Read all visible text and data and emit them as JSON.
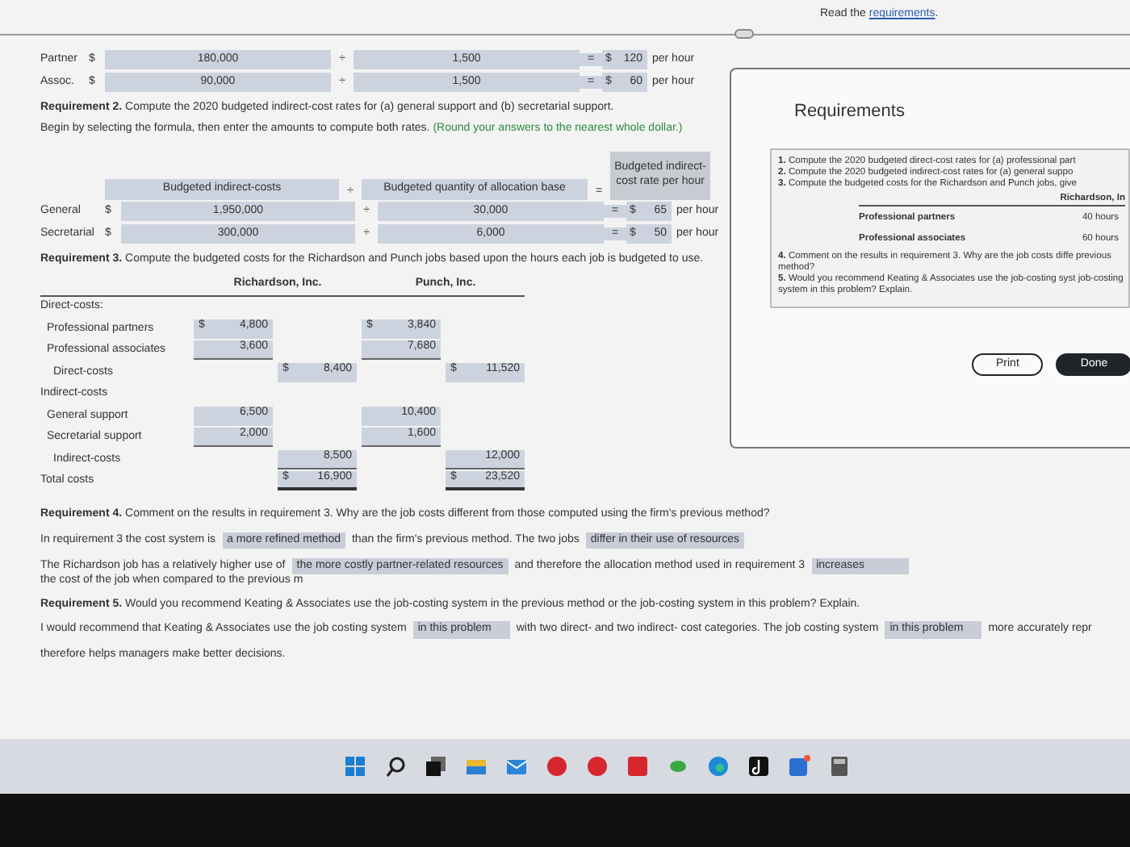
{
  "header": {
    "prefix": "Read the ",
    "link": "requirements",
    "suffix": "."
  },
  "direct_rates": {
    "rows": [
      {
        "label": "Partner",
        "currency": "$",
        "cost": "180,000",
        "divide": "÷",
        "quantity": "1,500",
        "equals": "=",
        "rate_currency": "$",
        "rate": "120",
        "unit": "per hour"
      },
      {
        "label": "Assoc.",
        "currency": "$",
        "cost": "90,000",
        "divide": "÷",
        "quantity": "1,500",
        "equals": "=",
        "rate_currency": "$",
        "rate": "60",
        "unit": "per hour"
      }
    ]
  },
  "requirement_2": {
    "title": "**Requirement 2.** Compute the 2020 budgeted indirect-cost rates for (a) general support and (b) secretarial support.",
    "instruction": "Begin by selecting the formula, then enter the amounts to compute both rates.",
    "hint": "(Round your answers to the nearest whole dollar.)",
    "formula": {
      "numerator": "Budgeted indirect-costs",
      "divide": "÷",
      "denominator": "Budgeted quantity of allocation base",
      "equals": "=",
      "result": "Budgeted indirect-cost rate per hour"
    },
    "rows": [
      {
        "label": "General",
        "currency": "$",
        "cost": "1,950,000",
        "divide": "÷",
        "quantity": "30,000",
        "equals": "=",
        "rate_currency": "$",
        "rate": "65",
        "unit": "per hour"
      },
      {
        "label": "Secretarial",
        "currency": "$",
        "cost": "300,000",
        "divide": "÷",
        "quantity": "6,000",
        "equals": "=",
        "rate_currency": "$",
        "rate": "50",
        "unit": "per hour"
      }
    ]
  },
  "requirement_3": {
    "title": "**Requirement 3.** Compute the budgeted costs for the Richardson and Punch jobs based upon the hours each job is budgeted to use.",
    "columns": [
      "Richardson, Inc.",
      "Punch, Inc."
    ],
    "rows": [
      {
        "kind": "heading",
        "label": "Direct-costs:"
      },
      {
        "kind": "item",
        "label": "Professional partners",
        "values": [
          {
            "currency": "$",
            "amount": "4,800"
          },
          {
            "currency": "$",
            "amount": "3,840"
          }
        ]
      },
      {
        "kind": "item",
        "label": "Professional associates",
        "values": [
          {
            "amount": "3,600"
          },
          {
            "amount": "7,680"
          }
        ]
      },
      {
        "kind": "subtotal",
        "label": "Direct-costs",
        "values": [
          {
            "currency": "$",
            "amount": "8,400"
          },
          {
            "currency": "$",
            "amount": "11,520"
          }
        ]
      },
      {
        "kind": "heading",
        "label": "Indirect-costs"
      },
      {
        "kind": "item",
        "label": "General support",
        "values": [
          {
            "amount": "6,500"
          },
          {
            "amount": "10,400"
          }
        ]
      },
      {
        "kind": "item",
        "label": "Secretarial support",
        "values": [
          {
            "amount": "2,000"
          },
          {
            "amount": "1,600"
          }
        ]
      },
      {
        "kind": "subtotal",
        "label": "Indirect-costs",
        "values": [
          {
            "amount": "8,500"
          },
          {
            "amount": "12,000"
          }
        ]
      },
      {
        "kind": "total",
        "label": "Total costs",
        "values": [
          {
            "currency": "$",
            "amount": "16,900"
          },
          {
            "currency": "$",
            "amount": "23,520"
          }
        ]
      }
    ]
  },
  "requirement_4": {
    "title": "**Requirement 4.** Comment on the results in requirement 3. Why are the job costs different from those computed using the firm's previous method?",
    "sentences": [
      [
        {
          "kind": "text",
          "text": "In requirement 3 the cost system is"
        },
        {
          "kind": "answer",
          "text": "a more refined method"
        },
        {
          "kind": "text",
          "text": "than the firm's previous method. The two jobs"
        },
        {
          "kind": "answer",
          "text": "differ in their use of resources"
        }
      ],
      [
        {
          "kind": "text",
          "text": "The Richardson job has a relatively higher use of"
        },
        {
          "kind": "answer",
          "text": "the more costly partner-related resources"
        },
        {
          "kind": "text",
          "text": "and therefore the allocation method used in requirement 3"
        },
        {
          "kind": "answer",
          "text": "increases"
        },
        {
          "kind": "text",
          "text": "the cost of the job when compared to the previous m"
        }
      ]
    ]
  },
  "requirement_5": {
    "title": "**Requirement 5.** Would you recommend Keating & Associates use the job-costing system in the previous method or the job-costing system in this problem? Explain.",
    "sentences": [
      [
        {
          "kind": "text",
          "text": "I would recommend that Keating & Associates use the job costing system"
        },
        {
          "kind": "answer",
          "text": "in this problem"
        },
        {
          "kind": "text",
          "text": "with two direct- and two indirect- cost categories. The job costing system"
        },
        {
          "kind": "answer",
          "text": "in this problem"
        },
        {
          "kind": "text",
          "text": "more accurately repr"
        }
      ],
      [
        {
          "kind": "text",
          "text": "therefore helps managers make better decisions."
        }
      ]
    ]
  },
  "dialog": {
    "title": "Requirements",
    "items_before": [
      "**1.** Compute the 2020 budgeted direct-cost rates for (a) professional part",
      "**2.** Compute the 2020 budgeted indirect-cost rates for (a) general suppo",
      "**3.** Compute the budgeted costs for the Richardson and Punch jobs, give"
    ],
    "table": {
      "column": "Richardson, In",
      "rows": [
        {
          "label": "Professional partners",
          "value": "40 hours"
        },
        {
          "label": "Professional associates",
          "value": "60 hours"
        }
      ]
    },
    "items_after": [
      "**4.** Comment on the results in requirement 3. Why are the job costs diffe previous method?",
      "**5.** Would you recommend Keating & Associates use the job-costing syst job-costing system in this problem? Explain."
    ],
    "buttons": [
      {
        "kind": "outline",
        "label": "Print"
      },
      {
        "kind": "dark",
        "label": "Done"
      }
    ]
  },
  "taskbar": {
    "icons": [
      {
        "kind": "start"
      },
      {
        "kind": "search"
      },
      {
        "kind": "taskview"
      },
      {
        "kind": "folder"
      },
      {
        "kind": "mail"
      },
      {
        "kind": "redcircle"
      },
      {
        "kind": "redcircle"
      },
      {
        "kind": "redsquare"
      },
      {
        "kind": "green"
      },
      {
        "kind": "edge"
      },
      {
        "kind": "music"
      },
      {
        "kind": "office"
      },
      {
        "kind": "calculator"
      }
    ]
  }
}
